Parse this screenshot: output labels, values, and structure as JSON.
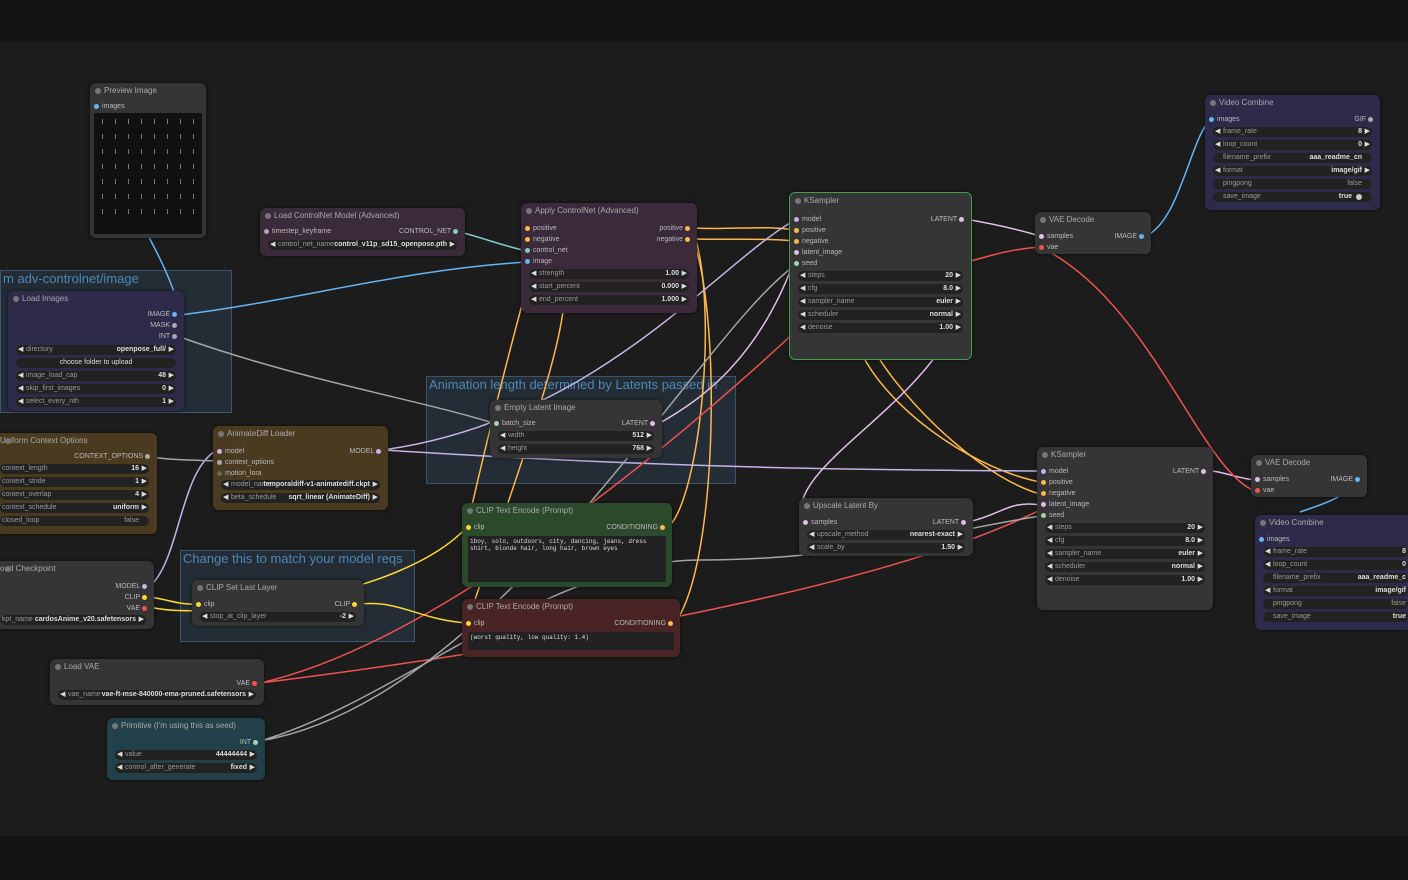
{
  "colors": {
    "background": "#1c1c1c",
    "node": "#353535",
    "group": "#3c6080"
  },
  "groups": {
    "controlnet": "m adv-controlnet/image",
    "latents": "Animation length determined by Latents passed in",
    "model_reqs": "Change this to match your model reqs"
  },
  "preview_image": {
    "title": "Preview Image",
    "images": "images"
  },
  "load_controlnet": {
    "title": "Load ControlNet Model (Advanced)",
    "in_timestep": "timestep_keyframe",
    "out": "CONTROL_NET",
    "w_label": "control_net_name",
    "w_value": "control_v11p_sd15_openpose.pth"
  },
  "apply_controlnet": {
    "title": "Apply ControlNet (Advanced)",
    "in1": "positive",
    "in2": "negative",
    "in3": "control_net",
    "in4": "image",
    "out1": "positive",
    "out2": "negative",
    "strength_l": "strength",
    "strength_v": "1.00",
    "start_l": "start_percent",
    "start_v": "0.000",
    "end_l": "end_percent",
    "end_v": "1.000"
  },
  "load_images": {
    "title": "Load Images",
    "out1": "IMAGE",
    "out2": "MASK",
    "out3": "INT",
    "dir_l": "directory",
    "dir_v": "openpose_full/",
    "upload": "choose folder to upload",
    "cap_l": "image_load_cap",
    "cap_v": "48",
    "skip_l": "skip_first_images",
    "skip_v": "0",
    "nth_l": "select_every_nth",
    "nth_v": "1"
  },
  "empty_latent": {
    "title": "Empty Latent Image",
    "in": "batch_size",
    "out": "LATENT",
    "w_l": "width",
    "w_v": "512",
    "h_l": "height",
    "h_v": "768"
  },
  "context": {
    "title": "Uniform Context Options",
    "out": "CONTEXT_OPTIONS",
    "len_l": "context_length",
    "len_v": "16",
    "stride_l": "context_stride",
    "stride_v": "1",
    "overlap_l": "context_overlap",
    "overlap_v": "4",
    "sched_l": "context_schedule",
    "sched_v": "uniform",
    "loop_l": "closed_loop",
    "loop_v": "false"
  },
  "animatediff": {
    "title": "AnimateDiff Loader",
    "in1": "model",
    "in2": "context_options",
    "in3": "motion_lora",
    "out": "MODEL",
    "model_l": "model_name",
    "model_v": "temporaldiff-v1-animatediff.ckpt",
    "beta_l": "beta_schedule",
    "beta_v": "sqrt_linear (AnimateDiff)"
  },
  "checkpoint": {
    "title": "oad Checkpoint",
    "out1": "MODEL",
    "out2": "CLIP",
    "out3": "VAE",
    "ck_l": "kpt_name",
    "ck_v": "cardosAnime_v20.safetensors"
  },
  "clip_last": {
    "title": "CLIP Set Last Layer",
    "in": "clip",
    "out": "CLIP",
    "w_l": "stop_at_clip_layer",
    "w_v": "-2"
  },
  "clip_pos": {
    "title": "CLIP Text Encode (Prompt)",
    "in": "clip",
    "out": "CONDITIONING",
    "text": "1boy, solo, outdoors, city, dancing, jeans, dress shirt, blonde hair, long hair, brown eyes"
  },
  "clip_neg": {
    "title": "CLIP Text Encode (Prompt)",
    "in": "clip",
    "out": "CONDITIONING",
    "text": "(worst quality, low quality: 1.4)"
  },
  "load_vae": {
    "title": "Load VAE",
    "out": "VAE",
    "w_l": "vae_name",
    "w_v": "vae-ft-mse-840000-ema-pruned.safetensors"
  },
  "primitive": {
    "title": "Primitive (I'm using this as seed)",
    "out": "INT",
    "val_l": "value",
    "val_v": "44444444",
    "ctl_l": "control_after_generate",
    "ctl_v": "fixed"
  },
  "ksampler1": {
    "title": "KSampler",
    "in1": "model",
    "in2": "positive",
    "in3": "negative",
    "in4": "latent_image",
    "in5": "seed",
    "out": "LATENT",
    "steps_l": "steps",
    "steps_v": "20",
    "cfg_l": "cfg",
    "cfg_v": "8.0",
    "sampler_l": "sampler_name",
    "sampler_v": "euler",
    "sched_l": "scheduler",
    "sched_v": "normal",
    "denoise_l": "denoise",
    "denoise_v": "1.00"
  },
  "vae_decode1": {
    "title": "VAE Decode",
    "in1": "samples",
    "in2": "vae",
    "out": "IMAGE"
  },
  "video1": {
    "title": "Video Combine",
    "in": "images",
    "out": "GIF",
    "fr_l": "frame_rate",
    "fr_v": "8",
    "loop_l": "loop_count",
    "loop_v": "0",
    "fp_l": "filename_prefix",
    "fp_v": "aaa_readme_cn",
    "fmt_l": "format",
    "fmt_v": "image/gif",
    "pp_l": "pingpong",
    "pp_v": "false",
    "save_l": "save_image",
    "save_v": "true"
  },
  "upscale": {
    "title": "Upscale Latent By",
    "in": "samples",
    "out": "LATENT",
    "m_l": "upscale_method",
    "m_v": "nearest-exact",
    "s_l": "scale_by",
    "s_v": "1.50"
  },
  "ksampler2": {
    "title": "KSampler",
    "in1": "model",
    "in2": "positive",
    "in3": "negative",
    "in4": "latent_image",
    "in5": "seed",
    "out": "LATENT",
    "steps_l": "steps",
    "steps_v": "20",
    "cfg_l": "cfg",
    "cfg_v": "8.0",
    "sampler_l": "sampler_name",
    "sampler_v": "euler",
    "sched_l": "scheduler",
    "sched_v": "normal",
    "denoise_l": "denoise",
    "denoise_v": "1.00"
  },
  "vae_decode2": {
    "title": "VAE Decode",
    "in1": "samples",
    "in2": "vae",
    "out": "IMAGE"
  },
  "video2": {
    "title": "Video Combine",
    "in": "images",
    "fr_l": "frame_rate",
    "fr_v": "8",
    "loop_l": "loop_count",
    "loop_v": "0",
    "fp_l": "filename_prefix",
    "fp_v": "aaa_readme_c",
    "fmt_l": "format",
    "fmt_v": "image/gif",
    "pp_l": "pingpong",
    "pp_v": "false",
    "save_l": "save_image",
    "save_v": "true"
  }
}
